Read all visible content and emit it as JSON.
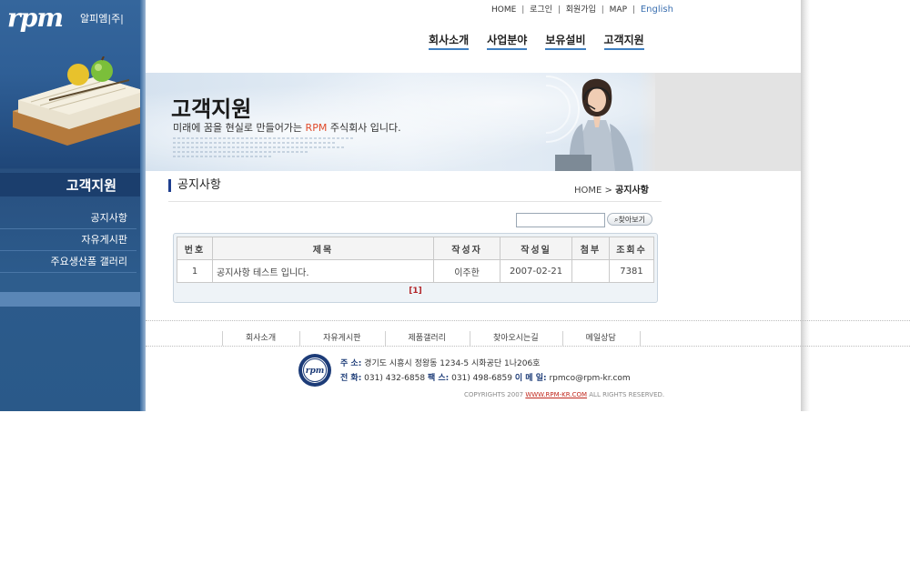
{
  "logo": {
    "main": "rpm",
    "sub": "알피엠|주|"
  },
  "util_nav": {
    "home": "HOME",
    "login": "로그인",
    "join": "회원가입",
    "map": "MAP",
    "english": "English",
    "sep": "|"
  },
  "main_nav": [
    "회사소개",
    "사업분야",
    "보유설비",
    "고객지원"
  ],
  "banner": {
    "title": "고객지원",
    "subtitle_pre": "미래에 꿈을 현실로 만들어가는 ",
    "subtitle_rpm": "RPM",
    "subtitle_post": " 주식회사 입니다."
  },
  "sidebar": {
    "title": "고객지원",
    "items": [
      "공지사항",
      "자유게시판",
      "주요생산품 갤러리"
    ]
  },
  "content": {
    "title": "공지사항",
    "breadcrumb_home": "HOME",
    "breadcrumb_sep": ">",
    "breadcrumb_current": "공지사항"
  },
  "search": {
    "value": "",
    "button_label": "찾아보기"
  },
  "board": {
    "headers": [
      "번호",
      "제목",
      "작성자",
      "작성일",
      "첨부",
      "조회수"
    ],
    "rows": [
      {
        "no": "1",
        "subject": "공지사항 테스트 입니다.",
        "author": "이주한",
        "date": "2007-02-21",
        "attach": "",
        "views": "7381"
      }
    ],
    "pager": "[1]"
  },
  "footer": {
    "nav": [
      "회사소개",
      "자유게시판",
      "제품갤러리",
      "찾아오시는길",
      "메일상담"
    ],
    "logo_text": "rpm",
    "address_label": "주    소:",
    "address": "경기도 시흥시 정왕동 1234-5 시화공단 1나206호",
    "phone_label": "전    화:",
    "phone": "031) 432-6858",
    "fax_label": "팩    스:",
    "fax": "031) 498-6859",
    "email_label": "이 메 일:",
    "email": "rpmco@rpm-kr.com",
    "copyright_pre": "COPYRIGHTS 2007 ",
    "copyright_site": "WWW.RPM-KR.COM",
    "copyright_post": " ALL RIGHTS RESERVED."
  },
  "colors": {
    "sidebar": "#2c5b8c",
    "accent": "#3f7fc0",
    "pager": "#b3262a",
    "rpm_red": "#e04a2a"
  }
}
